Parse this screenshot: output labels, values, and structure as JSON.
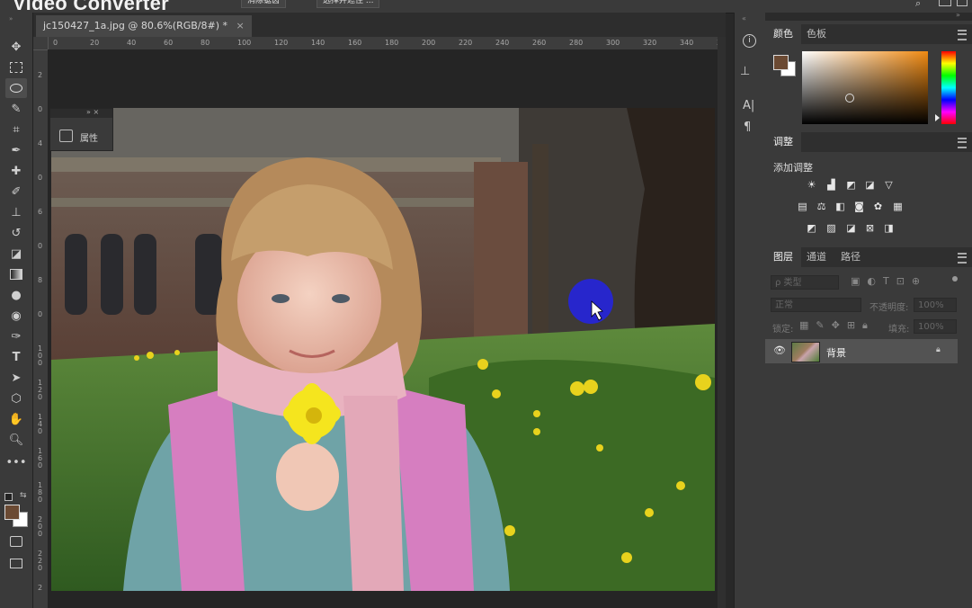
{
  "app": {
    "watermark": "Video Converter",
    "top_buttons": [
      "消除锯齿",
      "选择并遮住 ..."
    ]
  },
  "document": {
    "tab_title": "jc150427_1a.jpg @ 80.6%(RGB/8#) *",
    "tab_close": "×",
    "h_ruler_ticks": [
      "0",
      "20",
      "40",
      "60",
      "80",
      "100",
      "120",
      "140",
      "160",
      "180",
      "200",
      "220",
      "240",
      "260",
      "280",
      "300",
      "320",
      "340",
      "3"
    ],
    "v_ruler_ticks": [
      "2",
      "0",
      "4",
      "0",
      "6",
      "0",
      "8",
      "0",
      "1\n0\n0",
      "1\n2\n0",
      "1\n4\n0",
      "1\n6\n0",
      "1\n8\n0",
      "2\n0\n0",
      "2\n2\n0",
      "2"
    ]
  },
  "properties_panel": {
    "label": "属性",
    "header_icons": "»  ×"
  },
  "color_panel": {
    "tabs": [
      "颜色",
      "色板"
    ],
    "foreground": "#6b4a33",
    "background": "#ffffff"
  },
  "adjustments_panel": {
    "tab": "调整",
    "title": "添加调整"
  },
  "layers_panel": {
    "tabs": [
      "图层",
      "通道",
      "路径"
    ],
    "filter_placeholder": "ρ 类型",
    "blend_mode": "正常",
    "opacity_label": "不透明度:",
    "opacity_value": "100%",
    "lock_label": "锁定:",
    "fill_label": "填充:",
    "fill_value": "100%",
    "layers": [
      {
        "name": "背景",
        "visible": true,
        "locked": true
      }
    ]
  },
  "colors": {
    "panel_bg": "#3a3a3a",
    "tab_bg": "#2f2f2f",
    "canvas_bg": "#252525",
    "cursor_highlight": "#2323e6"
  }
}
